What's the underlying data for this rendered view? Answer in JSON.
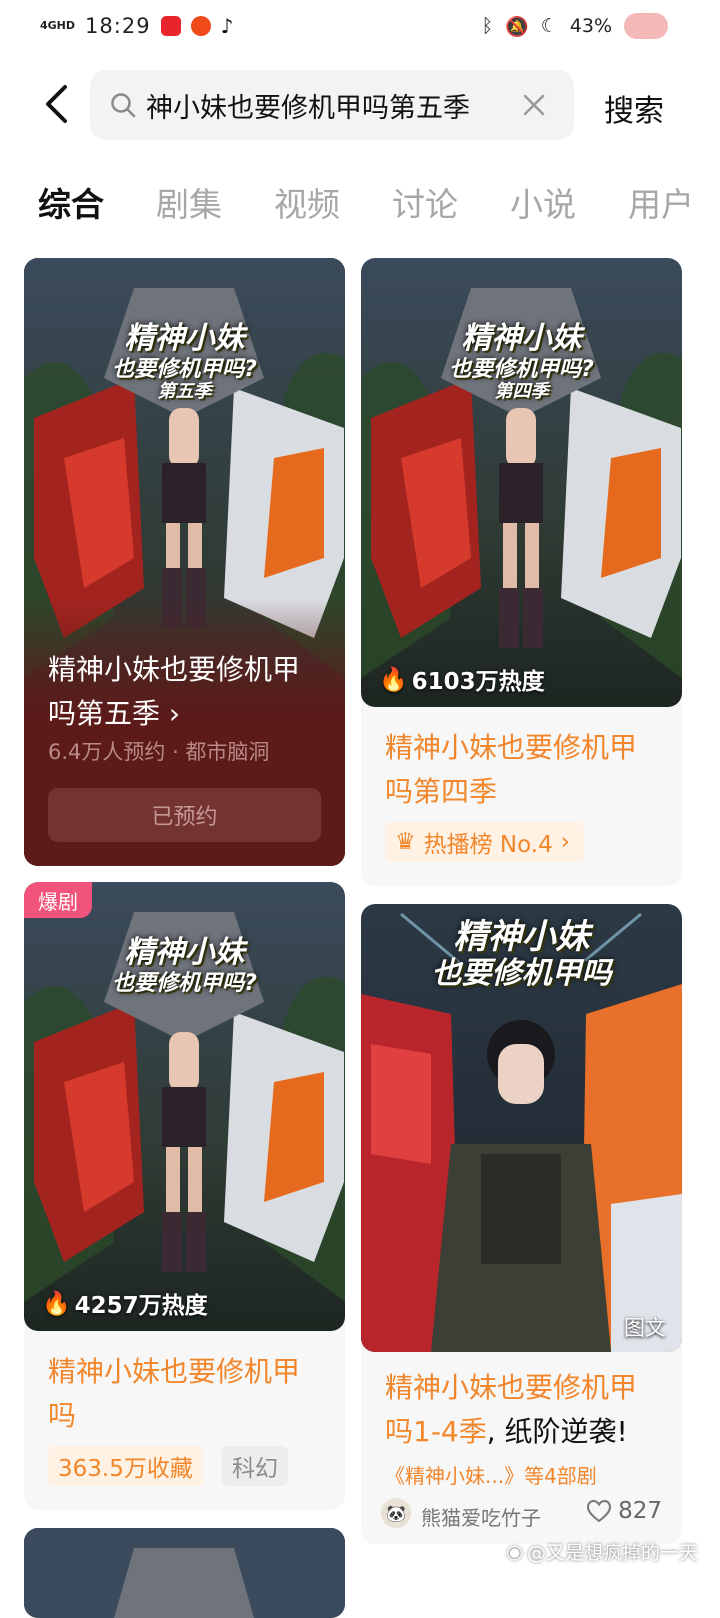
{
  "status_bar": {
    "network": "4GHD",
    "time": "18:29",
    "battery": "43%"
  },
  "search": {
    "value": "神小妹也要修机甲吗第五季",
    "button_label": "搜索"
  },
  "tabs": [
    {
      "label": "综合",
      "active": true
    },
    {
      "label": "剧集",
      "active": false
    },
    {
      "label": "视频",
      "active": false
    },
    {
      "label": "讨论",
      "active": false
    },
    {
      "label": "小说",
      "active": false
    },
    {
      "label": "用户",
      "active": false
    }
  ],
  "cards": {
    "c1": {
      "poster_title_line1": "精神小妹",
      "poster_title_line2": "也要修机甲吗?",
      "poster_title_line3": "第五季",
      "title": "精神小妹也要修机甲吗第五季",
      "subtitle": "6.4万人预约 · 都市脑洞",
      "button_label": "已预约",
      "bg_color": "#5c1a19"
    },
    "c2": {
      "poster_title_line1": "精神小妹",
      "poster_title_line2": "也要修机甲吗?",
      "poster_title_line3": "第四季",
      "heat": "6103万热度",
      "title": "精神小妹也要修机甲吗第四季",
      "rank": "热播榜 No.4"
    },
    "c3": {
      "badge": "爆剧",
      "poster_title_line1": "精神小妹",
      "poster_title_line2": "也要修机甲吗?",
      "heat": "4257万热度",
      "title": "精神小妹也要修机甲吗",
      "collect": "363.5万收藏",
      "genre": "科幻"
    },
    "c4": {
      "poster_title_line1": "精神小妹",
      "poster_title_line2": "也要修机甲吗",
      "image_tag": "图文",
      "title_part1": "精神小妹也要修机甲吗1-4季",
      "title_part2": ", 纸阶逆袭!",
      "related": "《精神小妹...》等4部剧",
      "author": "熊猫爱吃竹子",
      "likes": "827"
    }
  },
  "watermark": "@又是想疯掉的一天",
  "colors": {
    "accent_orange": "#f2862b",
    "dark_card": "#5c1a19"
  }
}
